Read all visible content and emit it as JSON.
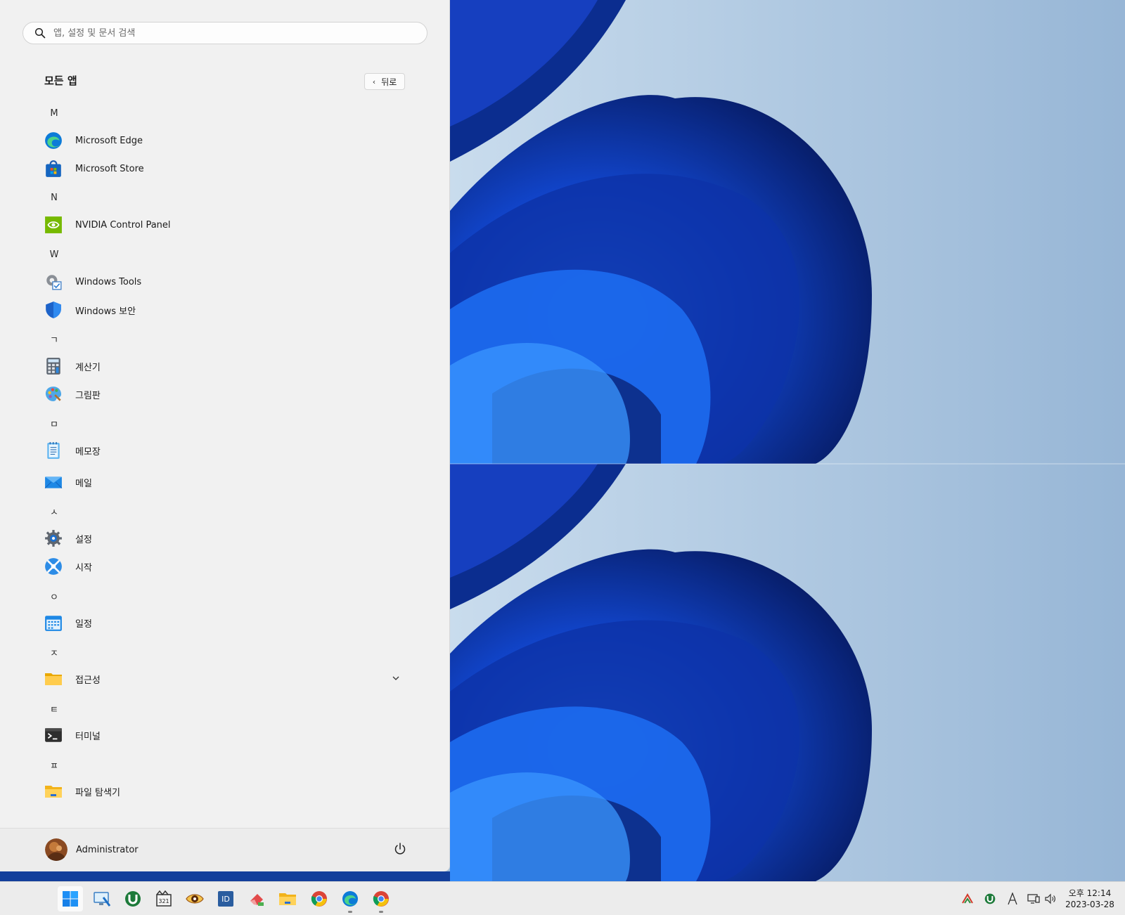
{
  "search": {
    "placeholder": "앱, 설정 및 문서 검색"
  },
  "all_apps": {
    "title": "모든 앱",
    "back_label": "뒤로"
  },
  "groups": [
    {
      "letter": "M",
      "apps": [
        {
          "label": "Microsoft Edge",
          "icon": "edge-icon"
        },
        {
          "label": "Microsoft Store",
          "icon": "store-icon"
        }
      ]
    },
    {
      "letter": "N",
      "apps": [
        {
          "label": "NVIDIA Control Panel",
          "icon": "nvidia-icon"
        }
      ]
    },
    {
      "letter": "W",
      "apps": [
        {
          "label": "Windows Tools",
          "icon": "windows-tools-icon"
        },
        {
          "label": "Windows 보안",
          "icon": "shield-icon"
        }
      ]
    },
    {
      "letter": "ㄱ",
      "apps": [
        {
          "label": "계산기",
          "icon": "calculator-icon"
        },
        {
          "label": "그림판",
          "icon": "paint-icon"
        }
      ]
    },
    {
      "letter": "ㅁ",
      "apps": [
        {
          "label": "메모장",
          "icon": "notepad-icon"
        },
        {
          "label": "메일",
          "icon": "mail-icon"
        }
      ]
    },
    {
      "letter": "ㅅ",
      "apps": [
        {
          "label": "설정",
          "icon": "settings-gear-icon"
        },
        {
          "label": "시작",
          "icon": "tips-icon"
        }
      ]
    },
    {
      "letter": "ㅇ",
      "apps": [
        {
          "label": "일정",
          "icon": "calendar-icon"
        }
      ]
    },
    {
      "letter": "ㅈ",
      "apps": [
        {
          "label": "접근성",
          "icon": "folder-icon",
          "expandable": true
        }
      ]
    },
    {
      "letter": "ㅌ",
      "apps": [
        {
          "label": "터미널",
          "icon": "terminal-icon"
        }
      ]
    },
    {
      "letter": "ㅍ",
      "apps": [
        {
          "label": "파일 탐색기",
          "icon": "file-explorer-icon"
        }
      ]
    }
  ],
  "user": {
    "name": "Administrator"
  },
  "taskbar": {
    "apps": [
      "windows-start-icon",
      "remote-desktop-icon",
      "utorrent-icon",
      "media-player-classic-icon",
      "eye-viewer-icon",
      "visual-studio-icon",
      "eraser-app-icon",
      "file-explorer-icon",
      "chrome-icon",
      "edge-icon",
      "chrome-icon"
    ],
    "tray": [
      "network-triangle-icon",
      "utorrent-tray-icon",
      "ime-a-icon",
      "display-network-icon",
      "volume-icon"
    ]
  },
  "clock": {
    "time": "오후 12:14",
    "date": "2023-03-28"
  },
  "colors": {
    "accent": "#0a5bd3",
    "menu_bg": "#f1f1f1",
    "taskbar_bg": "#ececec",
    "wallpaper_bg": "#9fbcd8",
    "bloom": "#1a4fd6"
  }
}
